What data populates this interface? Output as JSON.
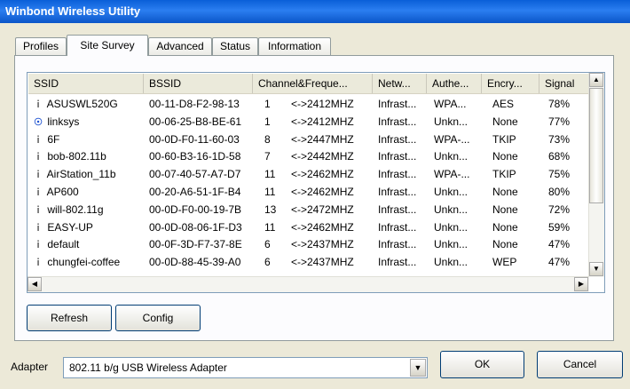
{
  "window": {
    "title": "Winbond Wireless Utility"
  },
  "tabs": [
    "Profiles",
    "Site Survey",
    "Advanced",
    "Status",
    "Information"
  ],
  "active_tab": "Site Survey",
  "table": {
    "columns": [
      "SSID",
      "BSSID",
      "Channel&Freque...",
      "Netw...",
      "Authe...",
      "Encry...",
      "Signal"
    ],
    "rows": [
      {
        "icon": "antenna-icon",
        "ssid": "ASUSWL520G",
        "bssid": "00-11-D8-F2-98-13",
        "channel": "1",
        "freq": "<->2412MHZ",
        "network": "Infrast...",
        "auth": "WPA...",
        "enc": "AES",
        "signal": "78%"
      },
      {
        "icon": "connected-antenna-icon",
        "ssid": "linksys",
        "bssid": "00-06-25-B8-BE-61",
        "channel": "1",
        "freq": "<->2412MHZ",
        "network": "Infrast...",
        "auth": "Unkn...",
        "enc": "None",
        "signal": "77%"
      },
      {
        "icon": "antenna-icon",
        "ssid": "6F",
        "bssid": "00-0D-F0-11-60-03",
        "channel": "8",
        "freq": "<->2447MHZ",
        "network": "Infrast...",
        "auth": "WPA-...",
        "enc": "TKIP",
        "signal": "73%"
      },
      {
        "icon": "antenna-icon",
        "ssid": "bob-802.11b",
        "bssid": "00-60-B3-16-1D-58",
        "channel": "7",
        "freq": "<->2442MHZ",
        "network": "Infrast...",
        "auth": "Unkn...",
        "enc": "None",
        "signal": "68%"
      },
      {
        "icon": "antenna-icon",
        "ssid": "AirStation_11b",
        "bssid": "00-07-40-57-A7-D7",
        "channel": "11",
        "freq": "<->2462MHZ",
        "network": "Infrast...",
        "auth": "WPA-...",
        "enc": "TKIP",
        "signal": "75%"
      },
      {
        "icon": "antenna-icon",
        "ssid": "AP600",
        "bssid": "00-20-A6-51-1F-B4",
        "channel": "11",
        "freq": "<->2462MHZ",
        "network": "Infrast...",
        "auth": "Unkn...",
        "enc": "None",
        "signal": "80%"
      },
      {
        "icon": "antenna-icon",
        "ssid": "will-802.11g",
        "bssid": "00-0D-F0-00-19-7B",
        "channel": "13",
        "freq": "<->2472MHZ",
        "network": "Infrast...",
        "auth": "Unkn...",
        "enc": "None",
        "signal": "72%"
      },
      {
        "icon": "antenna-icon",
        "ssid": "EASY-UP",
        "bssid": "00-0D-08-06-1F-D3",
        "channel": "11",
        "freq": "<->2462MHZ",
        "network": "Infrast...",
        "auth": "Unkn...",
        "enc": "None",
        "signal": "59%"
      },
      {
        "icon": "antenna-icon",
        "ssid": "default",
        "bssid": "00-0F-3D-F7-37-8E",
        "channel": "6",
        "freq": "<->2437MHZ",
        "network": "Infrast...",
        "auth": "Unkn...",
        "enc": "None",
        "signal": "47%"
      },
      {
        "icon": "antenna-icon",
        "ssid": "chungfei-coffee",
        "bssid": "00-0D-88-45-39-A0",
        "channel": "6",
        "freq": "<->2437MHZ",
        "network": "Infrast...",
        "auth": "Unkn...",
        "enc": "WEP",
        "signal": "47%"
      }
    ]
  },
  "buttons": {
    "refresh": "Refresh",
    "config": "Config",
    "ok": "OK",
    "cancel": "Cancel"
  },
  "adapter": {
    "label": "Adapter",
    "value": "802.11 b/g USB Wireless Adapter"
  },
  "colors": {
    "title_bar": "#0a5fd8",
    "face": "#ece9d8",
    "accent_orange": "#f4b23a"
  }
}
